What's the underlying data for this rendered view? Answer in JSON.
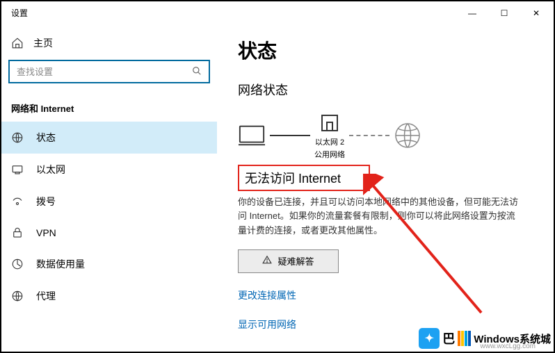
{
  "titlebar": {
    "title": "设置"
  },
  "window_controls": {
    "min": "—",
    "max": "☐",
    "close": "✕"
  },
  "sidebar": {
    "home_label": "主页",
    "search_placeholder": "查找设置",
    "section_title": "网络和 Internet",
    "items": [
      {
        "label": "状态"
      },
      {
        "label": "以太网"
      },
      {
        "label": "拨号"
      },
      {
        "label": "VPN"
      },
      {
        "label": "数据使用量"
      },
      {
        "label": "代理"
      }
    ]
  },
  "content": {
    "page_title": "状态",
    "sub_title": "网络状态",
    "diagram": {
      "eth_name": "以太网 2",
      "eth_type": "公用网络"
    },
    "status_text": "无法访问 Internet",
    "desc_text": "你的设备已连接，并且可以访问本地网络中的其他设备，但可能无法访问 Internet。如果你的流量套餐有限制，则你可以将此网络设置为按流量计费的连接，或者更改其他属性。",
    "troubleshoot_label": "疑难解答",
    "link_change": "更改连接属性",
    "link_show": "显示可用网络"
  },
  "watermark": {
    "text": "Windows系统城",
    "url": "www.wxcLgg.com"
  }
}
